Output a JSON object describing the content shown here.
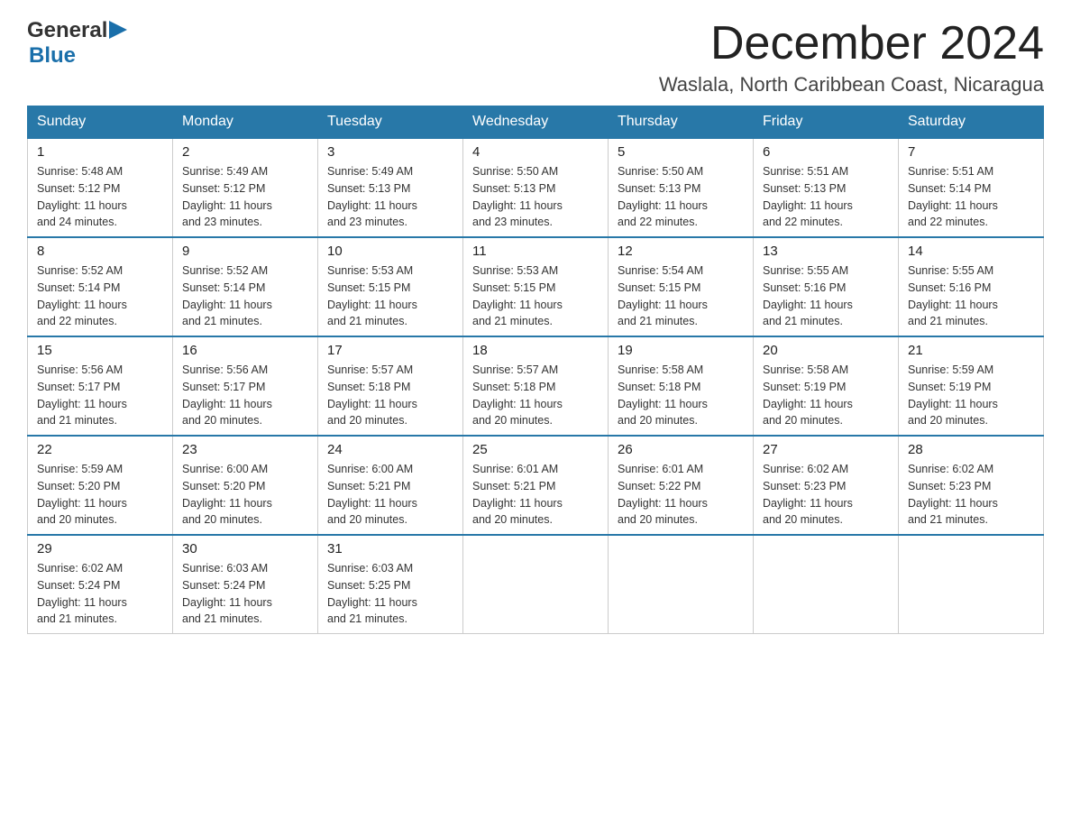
{
  "logo": {
    "general": "General",
    "blue": "Blue"
  },
  "header": {
    "month": "December 2024",
    "location": "Waslala, North Caribbean Coast, Nicaragua"
  },
  "days_of_week": [
    "Sunday",
    "Monday",
    "Tuesday",
    "Wednesday",
    "Thursday",
    "Friday",
    "Saturday"
  ],
  "weeks": [
    [
      {
        "day": "1",
        "sunrise": "5:48 AM",
        "sunset": "5:12 PM",
        "daylight": "11 hours and 24 minutes."
      },
      {
        "day": "2",
        "sunrise": "5:49 AM",
        "sunset": "5:12 PM",
        "daylight": "11 hours and 23 minutes."
      },
      {
        "day": "3",
        "sunrise": "5:49 AM",
        "sunset": "5:13 PM",
        "daylight": "11 hours and 23 minutes."
      },
      {
        "day": "4",
        "sunrise": "5:50 AM",
        "sunset": "5:13 PM",
        "daylight": "11 hours and 23 minutes."
      },
      {
        "day": "5",
        "sunrise": "5:50 AM",
        "sunset": "5:13 PM",
        "daylight": "11 hours and 22 minutes."
      },
      {
        "day": "6",
        "sunrise": "5:51 AM",
        "sunset": "5:13 PM",
        "daylight": "11 hours and 22 minutes."
      },
      {
        "day": "7",
        "sunrise": "5:51 AM",
        "sunset": "5:14 PM",
        "daylight": "11 hours and 22 minutes."
      }
    ],
    [
      {
        "day": "8",
        "sunrise": "5:52 AM",
        "sunset": "5:14 PM",
        "daylight": "11 hours and 22 minutes."
      },
      {
        "day": "9",
        "sunrise": "5:52 AM",
        "sunset": "5:14 PM",
        "daylight": "11 hours and 21 minutes."
      },
      {
        "day": "10",
        "sunrise": "5:53 AM",
        "sunset": "5:15 PM",
        "daylight": "11 hours and 21 minutes."
      },
      {
        "day": "11",
        "sunrise": "5:53 AM",
        "sunset": "5:15 PM",
        "daylight": "11 hours and 21 minutes."
      },
      {
        "day": "12",
        "sunrise": "5:54 AM",
        "sunset": "5:15 PM",
        "daylight": "11 hours and 21 minutes."
      },
      {
        "day": "13",
        "sunrise": "5:55 AM",
        "sunset": "5:16 PM",
        "daylight": "11 hours and 21 minutes."
      },
      {
        "day": "14",
        "sunrise": "5:55 AM",
        "sunset": "5:16 PM",
        "daylight": "11 hours and 21 minutes."
      }
    ],
    [
      {
        "day": "15",
        "sunrise": "5:56 AM",
        "sunset": "5:17 PM",
        "daylight": "11 hours and 21 minutes."
      },
      {
        "day": "16",
        "sunrise": "5:56 AM",
        "sunset": "5:17 PM",
        "daylight": "11 hours and 20 minutes."
      },
      {
        "day": "17",
        "sunrise": "5:57 AM",
        "sunset": "5:18 PM",
        "daylight": "11 hours and 20 minutes."
      },
      {
        "day": "18",
        "sunrise": "5:57 AM",
        "sunset": "5:18 PM",
        "daylight": "11 hours and 20 minutes."
      },
      {
        "day": "19",
        "sunrise": "5:58 AM",
        "sunset": "5:18 PM",
        "daylight": "11 hours and 20 minutes."
      },
      {
        "day": "20",
        "sunrise": "5:58 AM",
        "sunset": "5:19 PM",
        "daylight": "11 hours and 20 minutes."
      },
      {
        "day": "21",
        "sunrise": "5:59 AM",
        "sunset": "5:19 PM",
        "daylight": "11 hours and 20 minutes."
      }
    ],
    [
      {
        "day": "22",
        "sunrise": "5:59 AM",
        "sunset": "5:20 PM",
        "daylight": "11 hours and 20 minutes."
      },
      {
        "day": "23",
        "sunrise": "6:00 AM",
        "sunset": "5:20 PM",
        "daylight": "11 hours and 20 minutes."
      },
      {
        "day": "24",
        "sunrise": "6:00 AM",
        "sunset": "5:21 PM",
        "daylight": "11 hours and 20 minutes."
      },
      {
        "day": "25",
        "sunrise": "6:01 AM",
        "sunset": "5:21 PM",
        "daylight": "11 hours and 20 minutes."
      },
      {
        "day": "26",
        "sunrise": "6:01 AM",
        "sunset": "5:22 PM",
        "daylight": "11 hours and 20 minutes."
      },
      {
        "day": "27",
        "sunrise": "6:02 AM",
        "sunset": "5:23 PM",
        "daylight": "11 hours and 20 minutes."
      },
      {
        "day": "28",
        "sunrise": "6:02 AM",
        "sunset": "5:23 PM",
        "daylight": "11 hours and 21 minutes."
      }
    ],
    [
      {
        "day": "29",
        "sunrise": "6:02 AM",
        "sunset": "5:24 PM",
        "daylight": "11 hours and 21 minutes."
      },
      {
        "day": "30",
        "sunrise": "6:03 AM",
        "sunset": "5:24 PM",
        "daylight": "11 hours and 21 minutes."
      },
      {
        "day": "31",
        "sunrise": "6:03 AM",
        "sunset": "5:25 PM",
        "daylight": "11 hours and 21 minutes."
      },
      null,
      null,
      null,
      null
    ]
  ],
  "labels": {
    "sunrise": "Sunrise:",
    "sunset": "Sunset:",
    "daylight": "Daylight:"
  }
}
